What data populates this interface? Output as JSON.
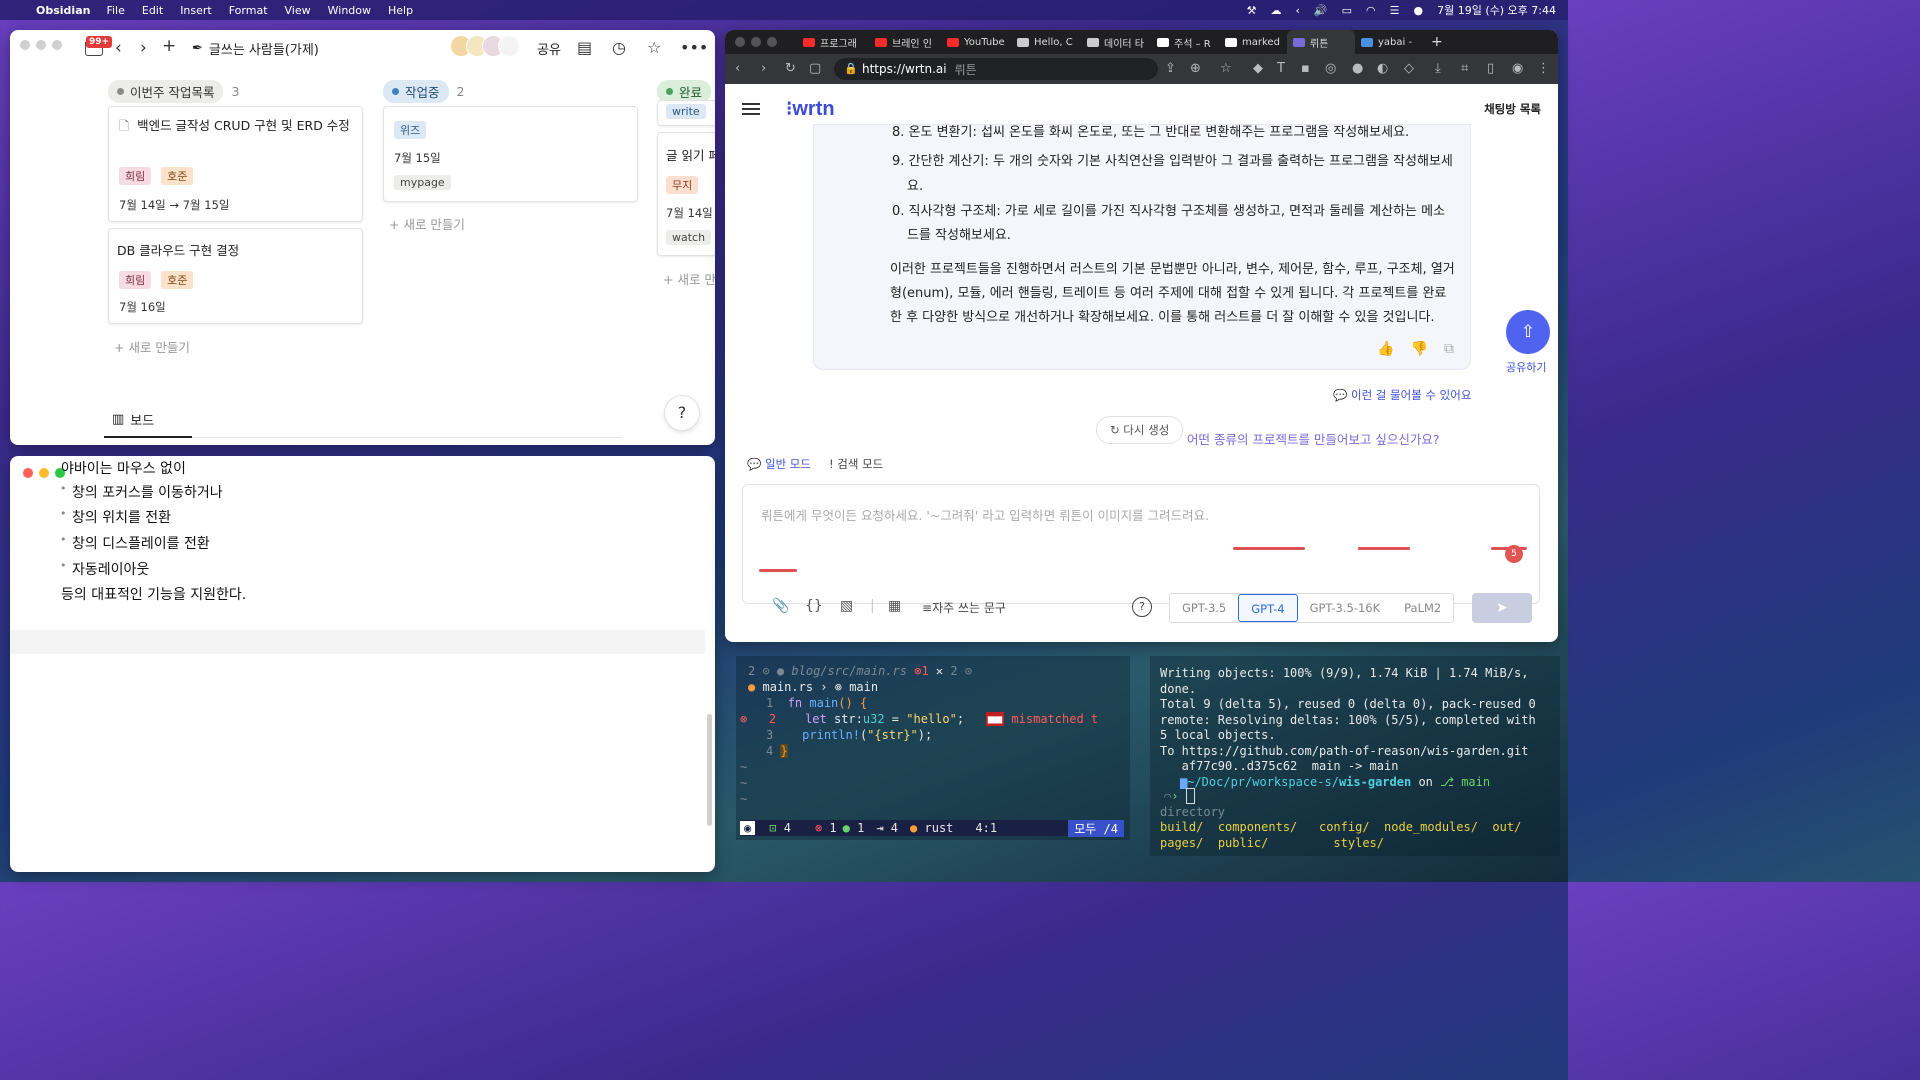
{
  "menubar": {
    "app": "Obsidian",
    "items": [
      "File",
      "Edit",
      "Insert",
      "Format",
      "View",
      "Window",
      "Help"
    ],
    "clock": "7월 19일 (수) 오후 7:44"
  },
  "obsidian": {
    "badge": "99+",
    "page_title": "글쓰는 사람들(가제)",
    "share": "공유",
    "columns": [
      {
        "title": "이번주 작업목록",
        "count": "3"
      },
      {
        "title": "작업중",
        "count": "2"
      },
      {
        "title": "완료",
        "count": ""
      }
    ],
    "col1_cards": [
      {
        "title": "백엔드 글작성 CRUD 구현 및 ERD 수정",
        "tags": [
          "희림",
          "호준"
        ],
        "date": "7월 14일 → 7월 15일"
      },
      {
        "title": "DB 클라우드 구현 결정",
        "tags": [
          "희림",
          "호준"
        ],
        "date": "7월 16일"
      }
    ],
    "col2_card": {
      "tag": "위즈",
      "date": "7월 15일",
      "label": "mypage"
    },
    "col3": {
      "top_tag": "write",
      "title": "글 읽기 페",
      "tag": "무지",
      "date": "7월 14일",
      "label": "watch",
      "new": "새로 만"
    },
    "new_item": "새로 만들기",
    "board_tab": "보드",
    "help": "?"
  },
  "notes": {
    "title": "야바이는 마우스 없이",
    "items": [
      "창의 포커스를 이동하거나",
      "창의 위치를 전환",
      "창의 디스플레이를 전환",
      "자동레이아웃"
    ],
    "tail": "등의 대표적인 기능을 지원한다."
  },
  "browser": {
    "tabs": [
      {
        "label": "프로그래",
        "color": "#ff2a2a"
      },
      {
        "label": "브레인 인",
        "color": "#ff2a2a"
      },
      {
        "label": "YouTube",
        "color": "#ff2a2a"
      },
      {
        "label": "Hello, C",
        "color": "#cccccc"
      },
      {
        "label": "데이터 타",
        "color": "#cccccc"
      },
      {
        "label": "주석 – R",
        "color": "#ffffff"
      },
      {
        "label": "marked",
        "color": "#ffffff"
      },
      {
        "label": "뤼튼",
        "color": "#7a6ad8"
      },
      {
        "label": "yabai -",
        "color": "#4a90e2"
      }
    ],
    "url": "https://wrtn.ai",
    "url_site": "뤼튼"
  },
  "wrtn": {
    "logo": "wrtn",
    "chat_list": "채팅방 목록",
    "lines": [
      "8. 온도 변환기: 섭씨 온도를 화씨 온도로, 또는 그 반대로 변환해주는 프로그램을 작성해보세요.",
      "9. 간단한 계산기: 두 개의 숫자와 기본 사칙연산을 입력받아 그 결과를 출력하는 프로그램을 작성해보세",
      "요.",
      "0. 직사각형 구조체: 가로 세로 길이를 가진 직사각형 구조체를 생성하고, 면적과 둘레를 계산하는 메소",
      "드를 작성해보세요."
    ],
    "summary": [
      "이러한 프로젝트들을 진행하면서 러스트의 기본 문법뿐만 아니라, 변수, 제어문, 함수, 루프, 구조체, 열거",
      "형(enum), 모듈, 에러 핸들링, 트레이트 등 여러 주제에 대해 접할 수 있게 됩니다. 각 프로젝트를 완료",
      "한 후 다양한 방식으로 개선하거나 확장해보세요. 이를 통해 러스트를 더 잘 이해할 수 있을 것입니다."
    ],
    "share_label": "공유하기",
    "suggest_link": "이런 걸 물어볼 수 있어요",
    "regen": "다시 생성",
    "suggest_chip": "어떤 종류의 프로젝트를 만들어보고 싶으신가요?",
    "mode_normal": "일반 모드",
    "mode_search": "검색 모드",
    "placeholder": "뤼튼에게 무엇이든 요청하세요. '~그려줘' 라고 입력하면 뤼튼이 이미지를 그려드려요.",
    "error_count": "5",
    "phrase": "자주 쓰는 문구",
    "models": [
      "GPT-3.5",
      "GPT-4",
      "GPT-3.5-16K",
      "PaLM2"
    ],
    "active_model": "GPT-4"
  },
  "editor": {
    "tab_left": "2",
    "path": "blog/src/main.rs",
    "err_count": "1",
    "tab_right": "2",
    "breadcrumb_file": "main.rs",
    "breadcrumb_sym": "main",
    "code": [
      {
        "n": "1",
        "text": "fn main() {"
      },
      {
        "n": "2",
        "text": "let str:u32 = \"hello\";"
      },
      {
        "n": "3",
        "text": "println!(\"{str}\");"
      },
      {
        "n": "4",
        "text": "}"
      }
    ],
    "diagnostic": "mismatched t",
    "status": {
      "lines": "4",
      "errors": "1",
      "hints": "1",
      "indent": "4",
      "lang": "rust",
      "pos": "4:1",
      "mode": "모두 /4"
    }
  },
  "shell": {
    "lines": [
      "Writing objects: 100% (9/9), 1.74 KiB | 1.74 MiB/s,",
      "done.",
      "Total 9 (delta 5), reused 0 (delta 0), pack-reused 0",
      "remote: Resolving deltas: 100% (5/5), completed with",
      " 5 local objects.",
      "To https://github.com/path-of-reason/wis-garden.git",
      "   af77c90..d375c62  main -> main"
    ],
    "prompt_path": "~/Doc/pr/workspace-s/",
    "prompt_repo": "wis-garden",
    "prompt_on": "on",
    "prompt_branch": "main",
    "heading": "directory",
    "dirs_row1": [
      "build/",
      "components/",
      "config/",
      "node_modules/",
      "out/"
    ],
    "dirs_row2": [
      "pages/",
      "public/",
      "styles/"
    ]
  }
}
